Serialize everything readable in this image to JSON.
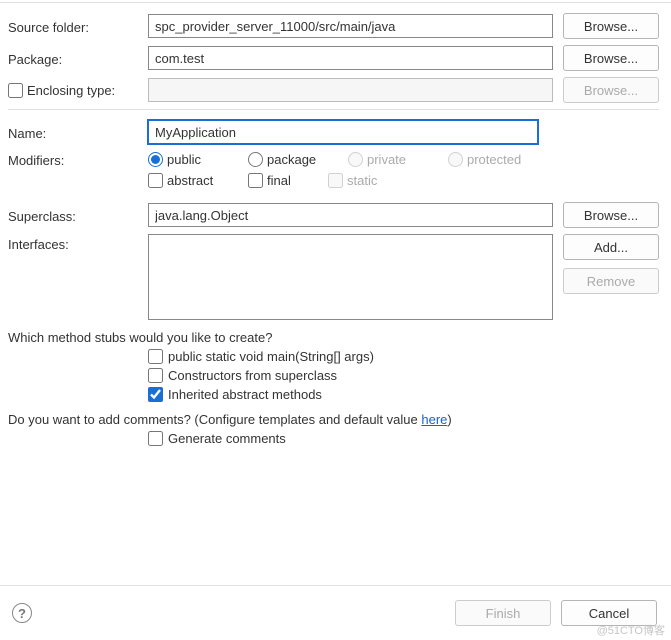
{
  "labels": {
    "source_folder": "Source folder:",
    "package": "Package:",
    "enclosing_type": "Enclosing type:",
    "name": "Name:",
    "modifiers": "Modifiers:",
    "superclass": "Superclass:",
    "interfaces": "Interfaces:"
  },
  "fields": {
    "source_folder": "spc_provider_server_11000/src/main/java",
    "package": "com.test",
    "enclosing_type": "",
    "name": "MyApplication",
    "superclass": "java.lang.Object"
  },
  "buttons": {
    "browse": "Browse...",
    "add": "Add...",
    "remove": "Remove",
    "finish": "Finish",
    "cancel": "Cancel"
  },
  "modifiers": {
    "access": {
      "public": "public",
      "package": "package",
      "private": "private",
      "protected": "protected"
    },
    "flags": {
      "abstract": "abstract",
      "final": "final",
      "static": "static"
    }
  },
  "prompts": {
    "stubs": "Which method stubs would you like to create?",
    "comments_prefix": "Do you want to add comments? (Configure templates and default value ",
    "comments_link": "here",
    "comments_suffix": ")"
  },
  "stubs": {
    "main": "public static void main(String[] args)",
    "constructors": "Constructors from superclass",
    "inherited": "Inherited abstract methods",
    "generate_comments": "Generate comments"
  },
  "state": {
    "enclosing_checked": false,
    "access_selected": "public",
    "abstract": false,
    "final": false,
    "static": false,
    "stub_main": false,
    "stub_constructors": false,
    "stub_inherited": true,
    "generate_comments": false
  },
  "watermark": "@51CTO博客"
}
